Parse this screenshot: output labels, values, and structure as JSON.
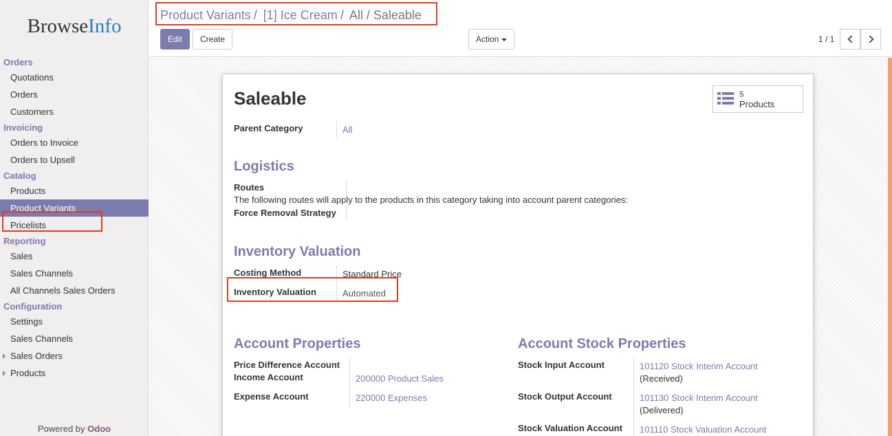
{
  "sidebar": {
    "logo_main": "Browse",
    "logo_accent": "Info",
    "sections": [
      {
        "title": "Orders",
        "items": [
          {
            "label": "Quotations"
          },
          {
            "label": "Orders"
          },
          {
            "label": "Customers"
          }
        ]
      },
      {
        "title": "Invoicing",
        "items": [
          {
            "label": "Orders to Invoice"
          },
          {
            "label": "Orders to Upsell"
          }
        ]
      },
      {
        "title": "Catalog",
        "items": [
          {
            "label": "Products"
          },
          {
            "label": "Product Variants",
            "active": true
          },
          {
            "label": "Pricelists"
          }
        ]
      },
      {
        "title": "Reporting",
        "items": [
          {
            "label": "Sales"
          },
          {
            "label": "Sales Channels"
          },
          {
            "label": "All Channels Sales Orders"
          }
        ]
      },
      {
        "title": "Configuration",
        "items": [
          {
            "label": "Settings"
          },
          {
            "label": "Sales Channels"
          },
          {
            "label": "Sales Orders",
            "expandable": true
          },
          {
            "label": "Products",
            "expandable": true
          }
        ]
      }
    ],
    "powered_prefix": "Powered by",
    "powered_brand": "Odoo"
  },
  "breadcrumb": {
    "items": [
      "Product Variants",
      "[1] Ice Cream"
    ],
    "separator": "/",
    "current": "All / Saleable"
  },
  "toolbar": {
    "edit_label": "Edit",
    "create_label": "Create",
    "action_label": "Action",
    "pager_text": "1 / 1"
  },
  "record": {
    "title": "Saleable",
    "smart_button": {
      "value": "5",
      "label": "Products",
      "icon": "list-icon"
    },
    "parent_category_label": "Parent Category",
    "parent_category_value": "All",
    "logistics": {
      "title": "Logistics",
      "routes_label": "Routes",
      "routes_note": "The following routes will apply to the products in this category taking into account parent categories:",
      "removal_label": "Force Removal Strategy"
    },
    "inventory_valuation": {
      "title": "Inventory Valuation",
      "costing_label": "Costing Method",
      "costing_value": "Standard Price",
      "valuation_label": "Inventory Valuation",
      "valuation_value": "Automated"
    },
    "account_properties": {
      "title": "Account Properties",
      "price_diff_label": "Price Difference Account",
      "income_label": "Income Account",
      "income_value": "200000 Product Sales",
      "expense_label": "Expense Account",
      "expense_value": "220000 Expenses"
    },
    "account_stock_properties": {
      "title": "Account Stock Properties",
      "input_label": "Stock Input Account",
      "input_value": "101120 Stock Interim Account",
      "input_sub": "(Received)",
      "output_label": "Stock Output Account",
      "output_value": "101130 Stock Interim Account",
      "output_sub": "(Delivered)",
      "valuation_label": "Stock Valuation Account",
      "valuation_value": "101110 Stock Valuation Account"
    }
  },
  "colors": {
    "accent": "#7c7bad",
    "highlight": "#e43a1f",
    "logo_accent": "#2d7fc0",
    "brand": "#875a7b"
  }
}
